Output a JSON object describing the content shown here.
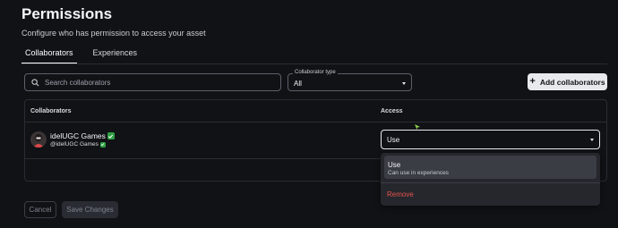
{
  "page": {
    "title": "Permissions",
    "subtitle": "Configure who has permission to access your asset"
  },
  "tabs": [
    {
      "label": "Collaborators",
      "active": true
    },
    {
      "label": "Experiences",
      "active": false
    }
  ],
  "search": {
    "placeholder": "Search collaborators",
    "icon": "search-icon"
  },
  "collaborator_type": {
    "label": "Collaborator type",
    "value": "All"
  },
  "add_button": {
    "label": "Add collaborators",
    "icon": "plus-icon"
  },
  "table": {
    "headers": {
      "collaborators": "Collaborators",
      "access": "Access"
    },
    "rows": [
      {
        "name": "idelUGC Games",
        "handle": "@idelUGC Games",
        "verified": true,
        "access": "Use"
      }
    ]
  },
  "access_menu": {
    "options": [
      {
        "label": "Use",
        "description": "Can use in experiences",
        "selected": true
      },
      {
        "label": "Remove",
        "description": ""
      }
    ]
  },
  "footer": {
    "cancel_label": "Cancel",
    "save_label": "Save Changes"
  },
  "colors": {
    "background": "#111216",
    "verified": "#2ea043",
    "danger": "#e5534b",
    "primary_button": "#e8e9ec"
  }
}
